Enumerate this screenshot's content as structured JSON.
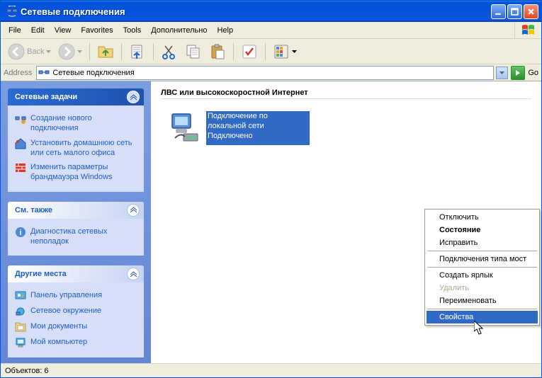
{
  "window": {
    "title": "Сетевые подключения"
  },
  "menubar": {
    "items": [
      "File",
      "Edit",
      "View",
      "Favorites",
      "Tools",
      "Дополнительно",
      "Help"
    ]
  },
  "toolbar": {
    "back_label": "Back"
  },
  "addressbar": {
    "label": "Address",
    "value": "Сетевые подключения",
    "go_label": "Go"
  },
  "sidebar": {
    "panels": [
      {
        "id": "tasks",
        "title": "Сетевые задачи",
        "links": [
          {
            "icon": "conn-new-icon",
            "text": "Создание нового подключения"
          },
          {
            "icon": "home-net-icon",
            "text": "Установить домашнюю сеть или сеть малого офиса"
          },
          {
            "icon": "firewall-icon",
            "text": "Изменить параметры брандмауэра Windows"
          }
        ]
      },
      {
        "id": "seealso",
        "title": "См. также",
        "links": [
          {
            "icon": "info-icon",
            "text": "Диагностика сетевых неполадок"
          }
        ]
      },
      {
        "id": "otherplaces",
        "title": "Другие места",
        "links": [
          {
            "icon": "cpanel-icon",
            "text": "Панель управления"
          },
          {
            "icon": "netplaces-icon",
            "text": "Сетевое окружение"
          },
          {
            "icon": "docs-icon",
            "text": "Мои документы"
          },
          {
            "icon": "computer-icon",
            "text": "Мой компьютер"
          }
        ]
      }
    ]
  },
  "main": {
    "section_title": "ЛВС или высокоскоростной Интернет",
    "connection": {
      "name": "Подключение по локальной сети",
      "status": "Подключено"
    }
  },
  "context_menu": {
    "items": [
      {
        "label": "Отключить"
      },
      {
        "label": "Состояние",
        "bold": true
      },
      {
        "label": "Исправить"
      },
      {
        "sep": true
      },
      {
        "label": "Подключения типа мост"
      },
      {
        "sep": true
      },
      {
        "label": "Создать ярлык"
      },
      {
        "label": "Удалить",
        "disabled": true
      },
      {
        "label": "Переименовать"
      },
      {
        "sep": true
      },
      {
        "label": "Свойства",
        "hl": true
      }
    ]
  },
  "statusbar": {
    "text": "Объектов: 6"
  }
}
